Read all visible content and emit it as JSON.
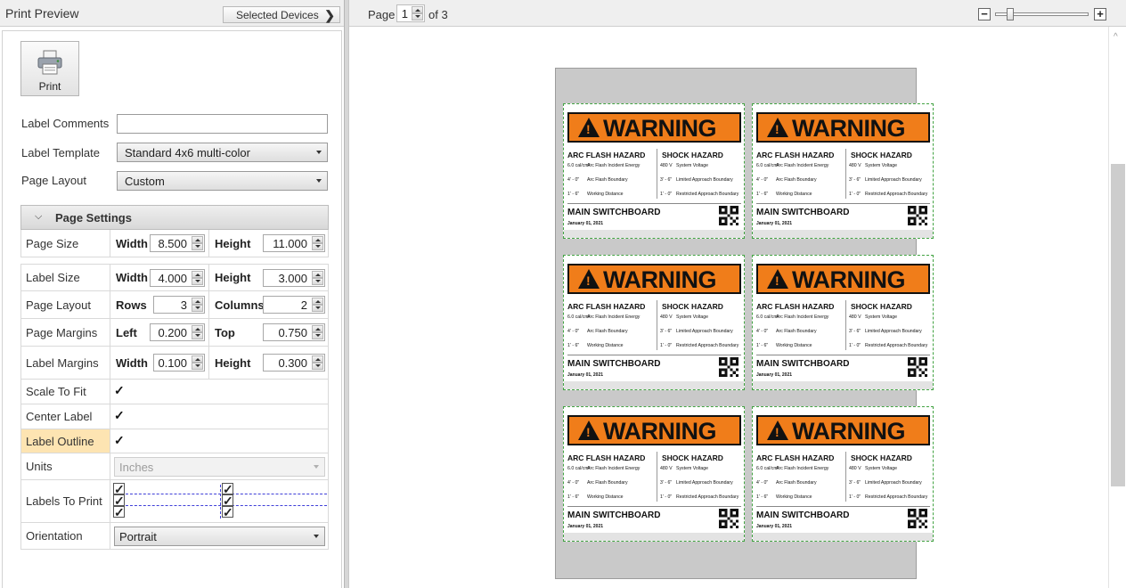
{
  "left_panel": {
    "title": "Print Preview",
    "selected_devices_label": "Selected Devices",
    "print_label": "Print",
    "label_comments_label": "Label Comments",
    "label_comments_value": "",
    "label_template_label": "Label Template",
    "label_template_value": "Standard 4x6 multi-color",
    "page_layout_label": "Page Layout",
    "page_layout_value": "Custom"
  },
  "page_settings": {
    "header": "Page Settings",
    "page_size": {
      "label": "Page Size",
      "a_label": "Width",
      "a_value": "8.500",
      "b_label": "Height",
      "b_value": "11.000"
    },
    "label_size": {
      "label": "Label Size",
      "a_label": "Width",
      "a_value": "4.000",
      "b_label": "Height",
      "b_value": "3.000"
    },
    "page_layout": {
      "label": "Page Layout",
      "a_label": "Rows",
      "a_value": "3",
      "b_label": "Columns",
      "b_value": "2"
    },
    "page_margins": {
      "label": "Page Margins",
      "a_label": "Left",
      "a_value": "0.200",
      "b_label": "Top",
      "b_value": "0.750"
    },
    "label_margins": {
      "label": "Label Margins",
      "a_label": "Width",
      "a_value": "0.100",
      "b_label": "Height",
      "b_value": "0.300"
    },
    "scale_to_fit": {
      "label": "Scale To Fit",
      "checked": true
    },
    "center_label": {
      "label": "Center Label",
      "checked": true
    },
    "label_outline": {
      "label": "Label Outline",
      "checked": true
    },
    "units": {
      "label": "Units",
      "value": "Inches"
    },
    "labels_to_print": {
      "label": "Labels To Print",
      "grid": [
        [
          true,
          true
        ],
        [
          true,
          true
        ],
        [
          true,
          true
        ]
      ]
    },
    "orientation": {
      "label": "Orientation",
      "value": "Portrait"
    }
  },
  "preview_toolbar": {
    "page_label": "Page",
    "page_value": "1",
    "of_label": "of 3",
    "zoom_minus": "−",
    "zoom_plus": "+"
  },
  "label_content": {
    "banner": "WARNING",
    "arc_heading": "ARC FLASH HAZARD",
    "shock_heading": "SHOCK HAZARD",
    "arc_rows": [
      {
        "value": "6.0 cal/cm²",
        "desc": "Arc Flash Incident Energy"
      },
      {
        "value": "4' - 0\"",
        "desc": "Arc Flash Boundary"
      },
      {
        "value": "1' - 6\"",
        "desc": "Working Distance"
      }
    ],
    "shock_rows": [
      {
        "value": "480 V",
        "desc": "System Voltage"
      },
      {
        "value": "3' - 6\"",
        "desc": "Limited Approach Boundary"
      },
      {
        "value": "1' - 0\"",
        "desc": "Restricted Approach Boundary"
      }
    ],
    "location": "MAIN SWITCHBOARD",
    "date": "January 01, 2021"
  },
  "colors": {
    "warning_orange": "#f07d1a",
    "outline_green": "#42a342",
    "highlight": "#fde4b2"
  },
  "icons": {
    "print": "printer-icon",
    "selected_devices": "chevron-right-icon",
    "page_settings_toggle": "chevron-down-icon",
    "label_warning": "warning-triangle-icon",
    "label_qr": "qr-code-icon"
  }
}
